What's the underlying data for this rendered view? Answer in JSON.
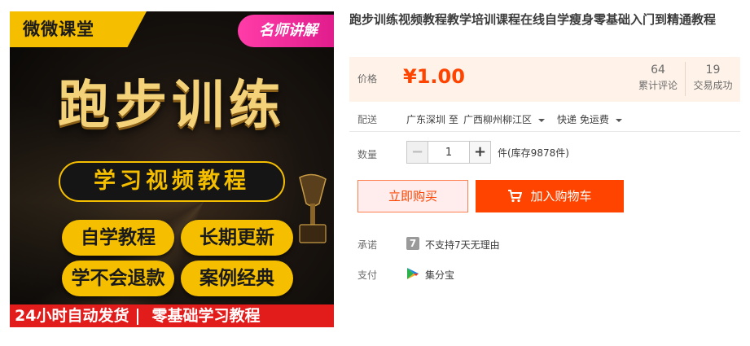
{
  "image_poster": {
    "brand": "微微课堂",
    "teacher_badge": "名师讲解",
    "main_title": "跑步训练",
    "subtitle": "学习视频教程",
    "tags": [
      "自学教程",
      "长期更新",
      "学不会退款",
      "案例经典"
    ],
    "bottom_banner": [
      "24小时自动发货",
      "零基础学习教程"
    ]
  },
  "product": {
    "title": "跑步训练视频教程教学培训课程在线自学瘦身零基础入门到精通教程"
  },
  "price": {
    "label": "价格",
    "value": "¥1.00",
    "reviews_count": "64",
    "reviews_label": "累计评论",
    "deals_count": "19",
    "deals_label": "交易成功"
  },
  "shipping": {
    "label": "配送",
    "from": "广东深圳 至",
    "to": "广西柳州柳江区",
    "method": "快递 免运费"
  },
  "quantity": {
    "label": "数量",
    "value": "1",
    "minus": "−",
    "plus": "+",
    "stock": "件(库存9878件)"
  },
  "actions": {
    "buy_now": "立即购买",
    "add_to_cart": "加入购物车"
  },
  "promise": {
    "label": "承诺",
    "icon_text": "7",
    "text": "不支持7天无理由"
  },
  "payment": {
    "label": "支付",
    "text": "集分宝"
  },
  "colors": {
    "accent": "#ff4400",
    "price_bg": "#fff2e8",
    "poster_gold": "#f5bf00",
    "banner_red": "#e21b1b"
  }
}
